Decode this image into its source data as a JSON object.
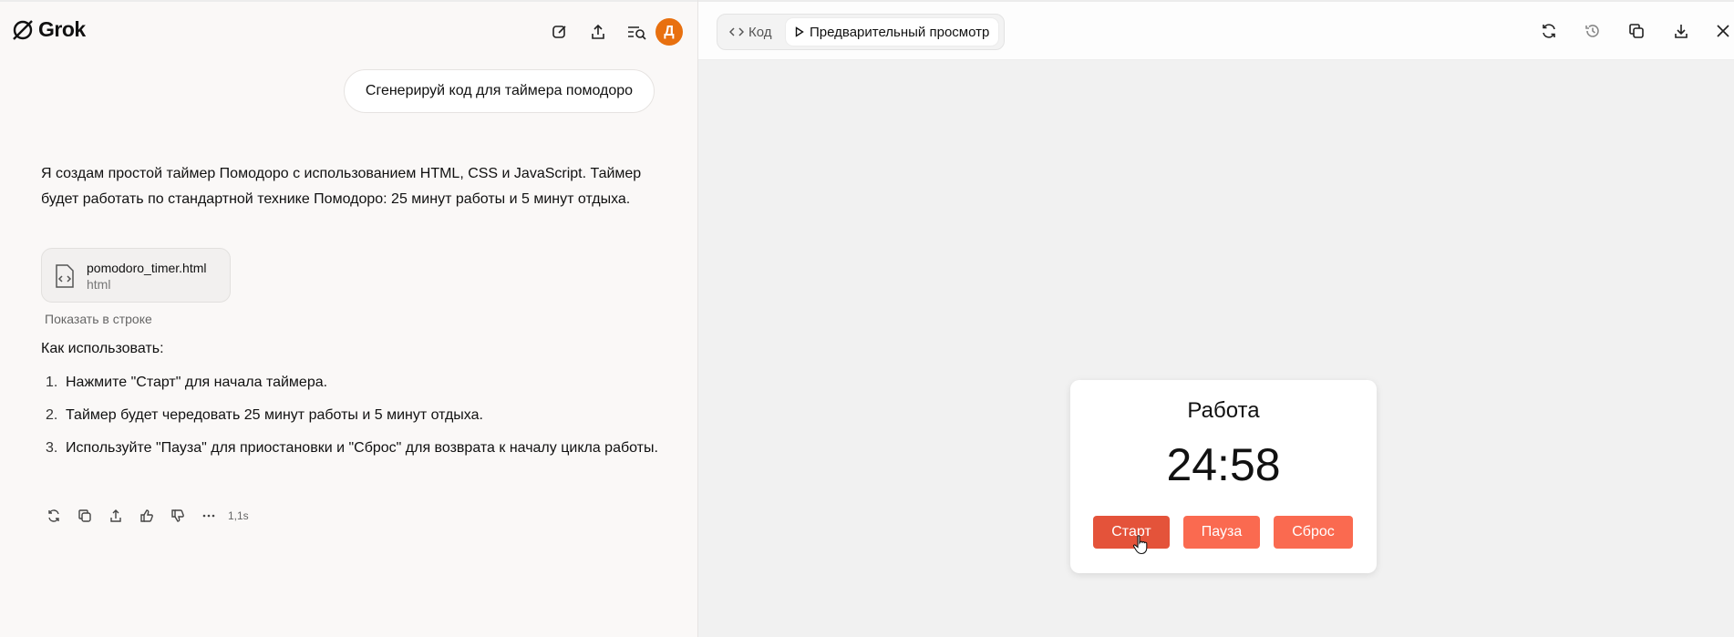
{
  "app": {
    "name": "Grok",
    "avatar_letter": "Д",
    "avatar_color": "#e8700f"
  },
  "chat": {
    "user_message": "Сгенерируй код для таймера помодоро",
    "answer_intro": "Я создам простой таймер Помодоро с использованием HTML, CSS и JavaScript. Таймер будет работать по стандартной технике Помодоро: 25 минут работы и 5 минут отдыха.",
    "file": {
      "name": "pomodoro_timer.html",
      "type": "html"
    },
    "show_inline_label": "Показать в строке",
    "howto_title": "Как использовать:",
    "steps": [
      {
        "num": "1.",
        "text": "Нажмите \"Старт\" для начала таймера."
      },
      {
        "num": "2.",
        "text": "Таймер будет чередовать 25 минут работы и 5 минут отдыха."
      },
      {
        "num": "3.",
        "text": "Используйте \"Пауза\" для приостановки и \"Сброс\" для возврата к началу цикла работы."
      }
    ],
    "elapsed": "1,1s"
  },
  "preview_panel": {
    "tabs": {
      "code": "Код",
      "preview": "Предварительный просмотр"
    },
    "active_tab": "preview"
  },
  "timer": {
    "mode": "Работа",
    "time": "24:58",
    "buttons": {
      "start": "Старт",
      "pause": "Пауза",
      "reset": "Сброс"
    },
    "colors": {
      "start": "#e4533a",
      "pause": "#fa6a50",
      "reset": "#fa6a50"
    }
  },
  "icons": {
    "left_header": [
      "new-chat-icon",
      "share-icon",
      "search-history-icon"
    ],
    "message_actions": [
      "regenerate-icon",
      "copy-icon",
      "share-icon",
      "thumbs-up-icon",
      "thumbs-down-icon",
      "more-icon"
    ],
    "right_header": [
      "refresh-icon",
      "history-icon",
      "copy-icon",
      "download-icon",
      "close-icon"
    ]
  }
}
